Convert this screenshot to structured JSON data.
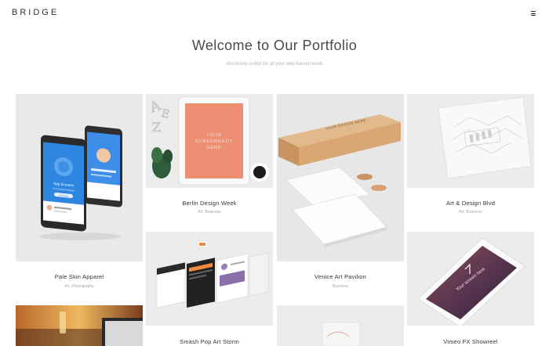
{
  "header": {
    "logo": "BRIDGE",
    "menu_icon": "hamburger-icon"
  },
  "hero": {
    "title": "Welcome to Our Portfolio",
    "subtitle": "Absolutely suited for all your web-based needs"
  },
  "mockups": {
    "app_screen_title": "App Screens",
    "app_screen_sub": "Pure Design Mockup",
    "app_screen_button": "Download",
    "tablet_text_lines": [
      "YOUR",
      "SCREENSHOT",
      "HERE"
    ],
    "box_text": "YOUR DESIGN HERE",
    "ipad_text": "Your screen here"
  },
  "portfolio": [
    {
      "title": "Pale Skin Apparel",
      "category": "Art, Photography"
    },
    {
      "title": "Berlin Design Week",
      "category": "Art, Business"
    },
    {
      "title": "Venice Art Pavilion",
      "category": "Business"
    },
    {
      "title": "Art & Design Blvd",
      "category": "Art, Business"
    },
    {
      "title": "Smash Pop Art Storm",
      "category": ""
    },
    {
      "title": "Vimeo FX Showreel",
      "category": ""
    }
  ]
}
